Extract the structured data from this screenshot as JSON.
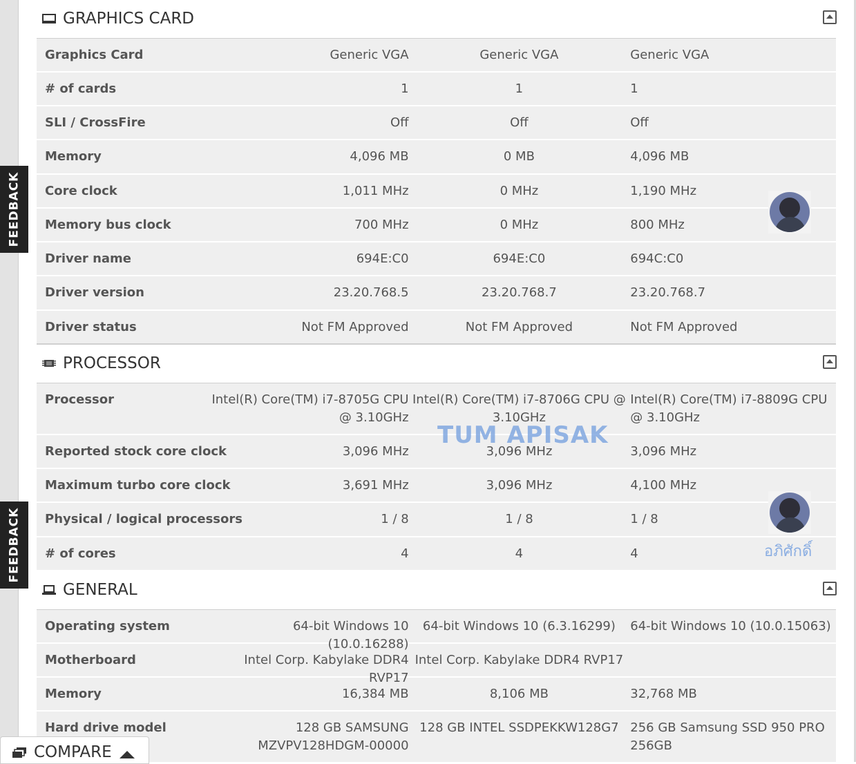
{
  "feedback": {
    "label": "FEEDBACK"
  },
  "sections": {
    "graphics": {
      "title": "GRAPHICS CARD",
      "rows": [
        {
          "label": "Graphics Card",
          "v1": "Generic VGA",
          "v2": "Generic VGA",
          "v3": "Generic VGA"
        },
        {
          "label": "# of cards",
          "v1": "1",
          "v2": "1",
          "v3": "1"
        },
        {
          "label": "SLI / CrossFire",
          "v1": "Off",
          "v2": "Off",
          "v3": "Off"
        },
        {
          "label": "Memory",
          "v1": "4,096 MB",
          "v2": "0 MB",
          "v3": "4,096 MB"
        },
        {
          "label": "Core clock",
          "v1": "1,011 MHz",
          "v2": "0 MHz",
          "v3": "1,190 MHz"
        },
        {
          "label": "Memory bus clock",
          "v1": "700 MHz",
          "v2": "0 MHz",
          "v3": "800 MHz"
        },
        {
          "label": "Driver name",
          "v1": "694E:C0",
          "v2": "694E:C0",
          "v3": "694C:C0"
        },
        {
          "label": "Driver version",
          "v1": "23.20.768.5",
          "v2": "23.20.768.7",
          "v3": "23.20.768.7"
        },
        {
          "label": "Driver status",
          "v1": "Not FM Approved",
          "v2": "Not FM Approved",
          "v3": "Not FM Approved"
        }
      ]
    },
    "processor": {
      "title": "PROCESSOR",
      "rows": [
        {
          "label": "Processor",
          "v1": "Intel(R) Core(TM) i7-8705G CPU @ 3.10GHz",
          "v2": "Intel(R) Core(TM) i7-8706G CPU @ 3.10GHz",
          "v3": "Intel(R) Core(TM) i7-8809G CPU @ 3.10GHz"
        },
        {
          "label": "Reported stock core clock",
          "v1": "3,096 MHz",
          "v2": "3,096 MHz",
          "v3": "3,096 MHz"
        },
        {
          "label": "Maximum turbo core clock",
          "v1": "3,691 MHz",
          "v2": "3,096 MHz",
          "v3": "4,100 MHz"
        },
        {
          "label": "Physical / logical processors",
          "v1": "1 / 8",
          "v2": "1 / 8",
          "v3": "1 / 8"
        },
        {
          "label": "# of cores",
          "v1": "4",
          "v2": "4",
          "v3": "4"
        }
      ]
    },
    "general": {
      "title": "GENERAL",
      "rows": [
        {
          "label": "Operating system",
          "v1": "64-bit Windows 10 (10.0.16288)",
          "v2": "64-bit Windows 10 (6.3.16299)",
          "v3": "64-bit Windows 10 (10.0.15063)"
        },
        {
          "label": "Motherboard",
          "v1": "Intel Corp. Kabylake DDR4 RVP17",
          "v2": "Intel Corp. Kabylake DDR4 RVP17",
          "v3": ""
        },
        {
          "label": "Memory",
          "v1": "16,384 MB",
          "v2": "8,106 MB",
          "v3": "32,768 MB"
        },
        {
          "label": "Hard drive model",
          "v1": "128 GB SAMSUNG MZVPV128HDGM-00000",
          "v2": "128 GB INTEL SSDPEKKW128G7",
          "v3": "256 GB Samsung SSD 950 PRO 256GB"
        }
      ]
    }
  },
  "watermark": {
    "text": "TUM APISAK",
    "thai": "อภิศักดิ์"
  },
  "compare": {
    "label": "COMPARE"
  }
}
